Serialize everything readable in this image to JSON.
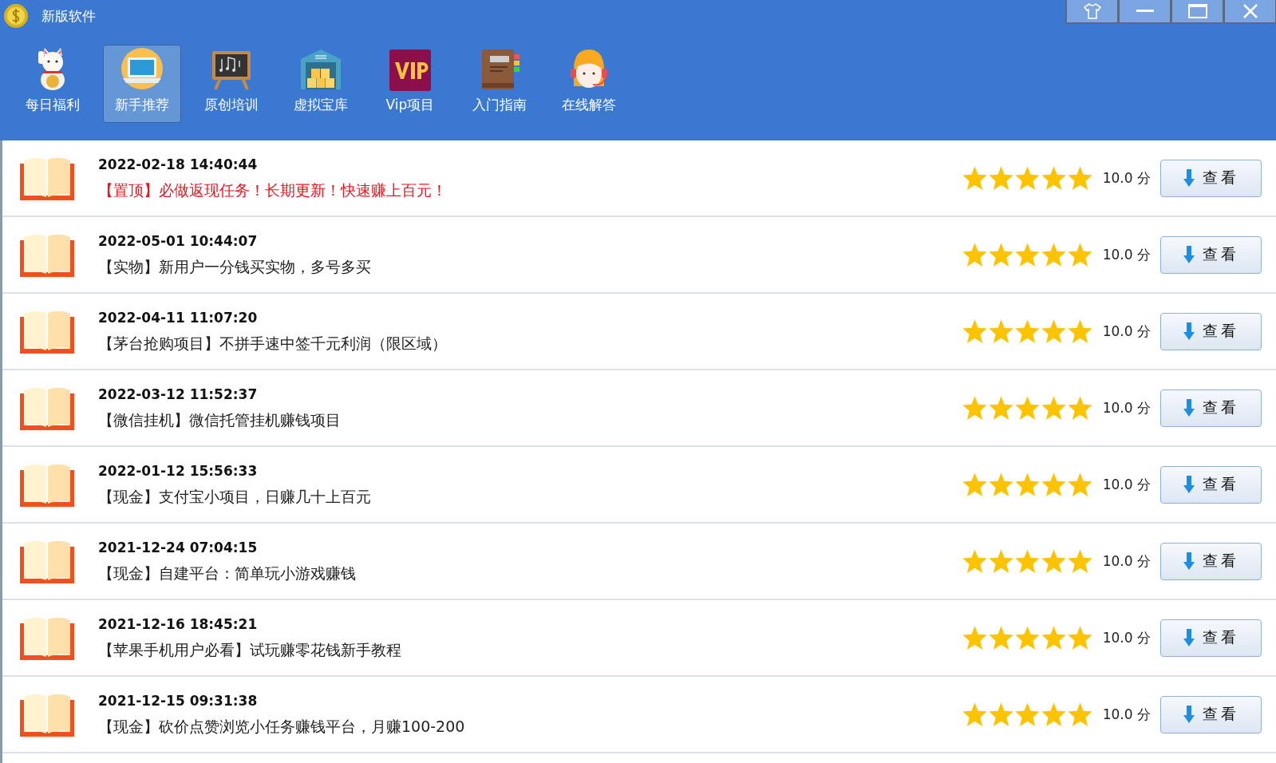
{
  "window": {
    "title": "新版软件"
  },
  "tools": [
    {
      "label": "每日福利",
      "selected": false
    },
    {
      "label": "新手推荐",
      "selected": true
    },
    {
      "label": "原创培训",
      "selected": false
    },
    {
      "label": "虚拟宝库",
      "selected": false
    },
    {
      "label": "Vip项目",
      "selected": false
    },
    {
      "label": "入门指南",
      "selected": false
    },
    {
      "label": "在线解答",
      "selected": false
    }
  ],
  "items": [
    {
      "date": "2022-02-18 14:40:44",
      "title": "【置顶】必做返现任务！长期更新！快速赚上百元！",
      "pinned": true,
      "stars": 5,
      "score": "10.0 分",
      "button": "查看"
    },
    {
      "date": "2022-05-01 10:44:07",
      "title": "【实物】新用户一分钱买实物，多号多买",
      "pinned": false,
      "stars": 5,
      "score": "10.0 分",
      "button": "查看"
    },
    {
      "date": "2022-04-11 11:07:20",
      "title": "【茅台抢购项目】不拼手速中签千元利润（限区域）",
      "pinned": false,
      "stars": 5,
      "score": "10.0 分",
      "button": "查看"
    },
    {
      "date": "2022-03-12 11:52:37",
      "title": "【微信挂机】微信托管挂机赚钱项目",
      "pinned": false,
      "stars": 5,
      "score": "10.0 分",
      "button": "查看"
    },
    {
      "date": "2022-01-12 15:56:33",
      "title": "【现金】支付宝小项目，日赚几十上百元",
      "pinned": false,
      "stars": 5,
      "score": "10.0 分",
      "button": "查看"
    },
    {
      "date": "2021-12-24 07:04:15",
      "title": "【现金】自建平台：简单玩小游戏赚钱",
      "pinned": false,
      "stars": 5,
      "score": "10.0 分",
      "button": "查看"
    },
    {
      "date": "2021-12-16 18:45:21",
      "title": "【苹果手机用户必看】试玩赚零花钱新手教程",
      "pinned": false,
      "stars": 5,
      "score": "10.0 分",
      "button": "查看"
    },
    {
      "date": "2021-12-15 09:31:38",
      "title": "【现金】砍价点赞浏览小任务赚钱平台，月赚100-200",
      "pinned": false,
      "stars": 5,
      "score": "10.0 分",
      "button": "查看"
    }
  ]
}
